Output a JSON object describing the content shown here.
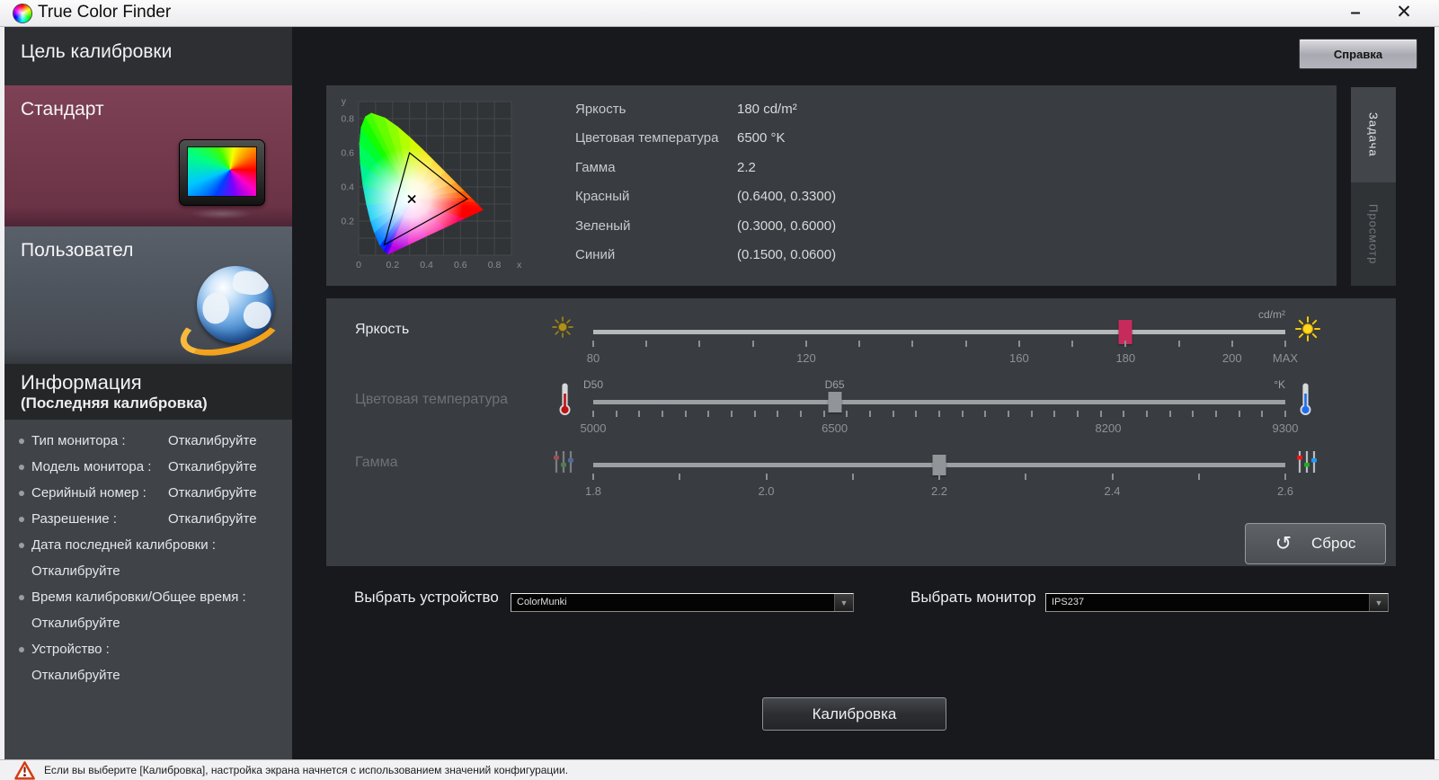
{
  "window": {
    "title": "True Color Finder",
    "minimize_glyph": "–",
    "close_glyph": "✕"
  },
  "header": {
    "help_button": "Справка"
  },
  "sidebar": {
    "title": "Цель калибровки",
    "modes": [
      {
        "label": "Стандарт"
      },
      {
        "label": "Пользовател"
      }
    ],
    "info_title": "Информация",
    "info_subtitle": "(Последняя калибровка)",
    "info_items": [
      {
        "label": "Тип монитора :",
        "value": "Откалибруйте",
        "layout": "inline"
      },
      {
        "label": "Модель монитора :",
        "value": "Откалибруйте",
        "layout": "inline"
      },
      {
        "label": "Серийный номер :",
        "value": "Откалибруйте",
        "layout": "inline"
      },
      {
        "label": "Разрешение :",
        "value": "Откалибруйте",
        "layout": "inline"
      },
      {
        "label": "Дата последней калибровки :",
        "value": "Откалибруйте",
        "layout": "block"
      },
      {
        "label": "Время калибровки/Общее время :",
        "value": "Откалибруйте",
        "layout": "block"
      },
      {
        "label": "Устройство :",
        "value": "Откалибруйте",
        "layout": "block"
      }
    ]
  },
  "tabs": [
    {
      "label": "Задача",
      "active": true
    },
    {
      "label": "Просмотр",
      "active": false
    }
  ],
  "readouts": [
    {
      "label": "Яркость",
      "value": "180 cd/m²"
    },
    {
      "label": "Цветовая температура",
      "value": "6500 °K"
    },
    {
      "label": "Гамма",
      "value": "2.2"
    },
    {
      "label": "Красный",
      "value": "(0.6400, 0.3300)"
    },
    {
      "label": "Зеленый",
      "value": "(0.3000, 0.6000)"
    },
    {
      "label": "Синий",
      "value": "(0.1500, 0.0600)"
    }
  ],
  "chart_data": {
    "type": "chromaticity-diagram",
    "xlabel": "x",
    "ylabel": "y",
    "xlim": [
      0,
      0.9
    ],
    "ylim": [
      0,
      0.9
    ],
    "x_ticks": [
      0,
      0.2,
      0.4,
      0.6,
      0.8
    ],
    "y_ticks": [
      0.2,
      0.4,
      0.6,
      0.8
    ],
    "grid": true,
    "gamut_triangle": {
      "red": [
        0.64,
        0.33
      ],
      "green": [
        0.3,
        0.6
      ],
      "blue": [
        0.15,
        0.06
      ]
    },
    "white_point": [
      0.313,
      0.329
    ],
    "spectral_locus": [
      [
        0.1741,
        0.005,
        "#7000c8"
      ],
      [
        0.1703,
        0.0058,
        "#6a00e0"
      ],
      [
        0.1658,
        0.0105,
        "#3d00ff"
      ],
      [
        0.1566,
        0.0177,
        "#2500ff"
      ],
      [
        0.144,
        0.0297,
        "#0030ff"
      ],
      [
        0.1241,
        0.0578,
        "#007bff"
      ],
      [
        0.0913,
        0.1327,
        "#00aeff"
      ],
      [
        0.0687,
        0.2007,
        "#00cdf0"
      ],
      [
        0.0454,
        0.295,
        "#00e4c0"
      ],
      [
        0.0235,
        0.4127,
        "#00f294"
      ],
      [
        0.0082,
        0.5384,
        "#00fb60"
      ],
      [
        0.0039,
        0.6548,
        "#00ff30"
      ],
      [
        0.0139,
        0.7502,
        "#15ff00"
      ],
      [
        0.0389,
        0.812,
        "#40ff00"
      ],
      [
        0.0743,
        0.8338,
        "#65ff00"
      ],
      [
        0.1547,
        0.8059,
        "#8cff00"
      ],
      [
        0.2296,
        0.7543,
        "#b2ff00"
      ],
      [
        0.3016,
        0.6923,
        "#d6f800"
      ],
      [
        0.3731,
        0.6245,
        "#f4e800"
      ],
      [
        0.4441,
        0.5547,
        "#ffcf00"
      ],
      [
        0.5125,
        0.4866,
        "#ffab00"
      ],
      [
        0.5752,
        0.4242,
        "#ff8300"
      ],
      [
        0.627,
        0.3725,
        "#ff5a00"
      ],
      [
        0.6658,
        0.334,
        "#ff3200"
      ],
      [
        0.6915,
        0.3083,
        "#ff1600"
      ],
      [
        0.714,
        0.2859,
        "#ff0600"
      ],
      [
        0.7347,
        0.2653,
        "#ff0000"
      ],
      [
        0.6226,
        0.2132,
        "#ff0058"
      ],
      [
        0.5105,
        0.1612,
        "#ff0090"
      ],
      [
        0.3983,
        0.1091,
        "#f000c0"
      ],
      [
        0.2862,
        0.0571,
        "#b800e0"
      ],
      [
        0.1741,
        0.005,
        "#7000c8"
      ]
    ]
  },
  "sliders": {
    "brightness": {
      "label": "Яркость",
      "enabled": true,
      "unit": "cd/m²",
      "min": 80,
      "max": 210,
      "value": 180,
      "handle_color": "#c62b5c",
      "tick_count": 14,
      "labels": [
        {
          "v": 80,
          "t": "80"
        },
        {
          "v": 120,
          "t": "120"
        },
        {
          "v": 160,
          "t": "160"
        },
        {
          "v": 180,
          "t": "180"
        },
        {
          "v": 200,
          "t": "200"
        },
        {
          "v": 210,
          "t": "MAX"
        }
      ],
      "top_labels": []
    },
    "temperature": {
      "label": "Цветовая температура",
      "enabled": false,
      "unit": "°K",
      "min": 5000,
      "max": 9300,
      "value": 6500,
      "handle_color": "#919598",
      "tick_count": 31,
      "labels": [
        {
          "v": 5000,
          "t": "5000"
        },
        {
          "v": 6500,
          "t": "6500"
        },
        {
          "v": 8200,
          "t": "8200"
        },
        {
          "v": 9300,
          "t": "9300"
        }
      ],
      "top_labels": [
        {
          "v": 5000,
          "t": "D50"
        },
        {
          "v": 6500,
          "t": "D65"
        }
      ]
    },
    "gamma": {
      "label": "Гамма",
      "enabled": false,
      "unit": "",
      "min": 1.8,
      "max": 2.6,
      "value": 2.2,
      "handle_color": "#919598",
      "tick_count": 9,
      "labels": [
        {
          "v": 1.8,
          "t": "1.8"
        },
        {
          "v": 2.0,
          "t": "2.0"
        },
        {
          "v": 2.2,
          "t": "2.2"
        },
        {
          "v": 2.4,
          "t": "2.4"
        },
        {
          "v": 2.6,
          "t": "2.6"
        }
      ],
      "top_labels": []
    }
  },
  "reset_button": {
    "label": "Сброс",
    "icon": "↺"
  },
  "selects": {
    "device": {
      "label": "Выбрать устройство",
      "value": "ColorMunki"
    },
    "monitor": {
      "label": "Выбрать монитор",
      "value": "IPS237"
    }
  },
  "calibrate_button": {
    "label": "Калибровка"
  },
  "status_bar": {
    "text": "Если вы выберите [Калибровка], настройка экрана начнется с использованием значений конфигурации."
  }
}
